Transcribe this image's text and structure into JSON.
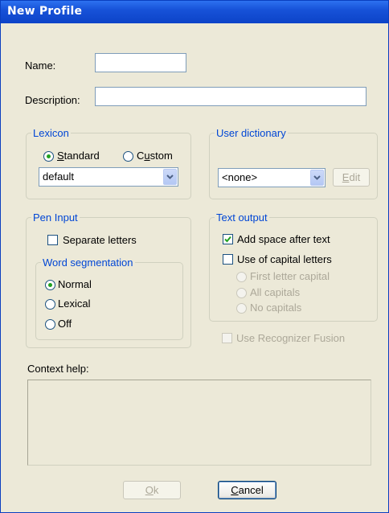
{
  "window": {
    "title": "New Profile"
  },
  "profile": {
    "name_label": "Name:",
    "name_value": "",
    "description_label": "Description:",
    "description_value": ""
  },
  "lexicon": {
    "legend": "Lexicon",
    "standard_pre": "",
    "standard_ul": "S",
    "standard_post": "tandard",
    "custom_pre": "C",
    "custom_ul": "u",
    "custom_post": "stom",
    "selected": "Standard",
    "combo_value": "default"
  },
  "user_dictionary": {
    "legend": "User dictionary",
    "combo_value": "<none>",
    "edit_pre": "",
    "edit_ul": "E",
    "edit_post": "dit"
  },
  "pen_input": {
    "legend": "Pen Input",
    "separate_letters": "Separate letters",
    "separate_letters_checked": false,
    "word_segmentation": {
      "legend": "Word segmentation",
      "options": [
        "Normal",
        "Lexical",
        "Off"
      ],
      "selected": "Normal"
    }
  },
  "text_output": {
    "legend": "Text output",
    "add_space": "Add space after text",
    "add_space_checked": true,
    "capital_letters": "Use of capital letters",
    "capital_letters_checked": false,
    "capital_options": [
      "First letter capital",
      "All capitals",
      "No capitals"
    ]
  },
  "recognizer_fusion": {
    "label": "Use Recognizer Fusion",
    "checked": false
  },
  "context_help": {
    "label": "Context help:",
    "text": ""
  },
  "buttons": {
    "ok_ul": "O",
    "ok_post": "k",
    "cancel_ul": "C",
    "cancel_post": "ancel"
  },
  "colors": {
    "title_bar": "#0c43c8",
    "legend_text": "#0046d5",
    "dialog_bg": "#ece9d8"
  }
}
